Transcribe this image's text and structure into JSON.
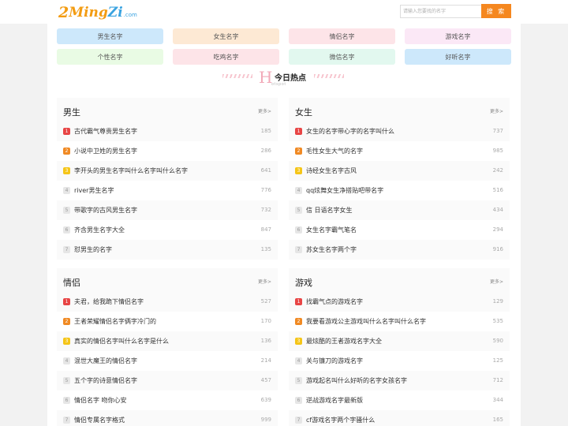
{
  "header": {
    "logo_num": "2",
    "logo_m": "M",
    "logo_ing": "ing",
    "logo_z": "Zi",
    "logo_dotcom": ".com",
    "search_placeholder": "请输入您要找的名字",
    "search_button": "搜 索"
  },
  "categories": [
    {
      "label": "男生名字",
      "color": "#cde8fb"
    },
    {
      "label": "女生名字",
      "color": "#fde9d4"
    },
    {
      "label": "情侣名字",
      "color": "#fde4e8"
    },
    {
      "label": "游戏名字",
      "color": "#fbe8f6"
    },
    {
      "label": "个性名字",
      "color": "#e9fbe4"
    },
    {
      "label": "吃鸡名字",
      "color": "#fde4e8"
    },
    {
      "label": "微信名字",
      "color": "#e2f8ef"
    },
    {
      "label": "好听名字",
      "color": "#cde8fb"
    }
  ],
  "hot": {
    "big_letter": "H",
    "label": "今日热点",
    "sub": "otspot"
  },
  "more_label": "更多>",
  "panels": [
    {
      "title": "男生",
      "items": [
        {
          "rank": "1",
          "text": "古代霸气尊贵男生名字",
          "count": "185"
        },
        {
          "rank": "2",
          "text": "小说中卫姓的男生名字",
          "count": "286"
        },
        {
          "rank": "3",
          "text": "李开头的男生名字叫什么名字叫什么名字",
          "count": "641"
        },
        {
          "rank": "4",
          "text": "river男生名字",
          "count": "776"
        },
        {
          "rank": "5",
          "text": "带歌字的古风男生名字",
          "count": "732"
        },
        {
          "rank": "6",
          "text": "齐含男生名字大全",
          "count": "847"
        },
        {
          "rank": "7",
          "text": "怼男生的名字",
          "count": "135"
        }
      ]
    },
    {
      "title": "女生",
      "items": [
        {
          "rank": "1",
          "text": "女生的名字带心字的名字叫什么",
          "count": "737"
        },
        {
          "rank": "2",
          "text": "毛性女生大气的名字",
          "count": "985"
        },
        {
          "rank": "3",
          "text": "诗经女生名字古风",
          "count": "242"
        },
        {
          "rank": "4",
          "text": "qq炫舞女生净搭贴吧带名字",
          "count": "516"
        },
        {
          "rank": "5",
          "text": "信 日语名字女生",
          "count": "434"
        },
        {
          "rank": "6",
          "text": "女生名字霸气笔名",
          "count": "294"
        },
        {
          "rank": "7",
          "text": "苏女生名字两个字",
          "count": "916"
        }
      ]
    },
    {
      "title": "情侣",
      "items": [
        {
          "rank": "1",
          "text": "夫君，给我跪下情侣名字",
          "count": "527"
        },
        {
          "rank": "2",
          "text": "王者荣耀情侣名字俩字冷门的",
          "count": "170"
        },
        {
          "rank": "3",
          "text": "真实的情侣名字叫什么名字是什么",
          "count": "136"
        },
        {
          "rank": "4",
          "text": "混世大魔王的情侣名字",
          "count": "214"
        },
        {
          "rank": "5",
          "text": "五个字的诗意情侣名字",
          "count": "457"
        },
        {
          "rank": "6",
          "text": "情侣名字 吻你心安",
          "count": "639"
        },
        {
          "rank": "7",
          "text": "情侣专属名字格式",
          "count": "999"
        }
      ]
    },
    {
      "title": "游戏",
      "items": [
        {
          "rank": "1",
          "text": "找霸气点的游戏名字",
          "count": "129"
        },
        {
          "rank": "2",
          "text": "我要看游戏公主游戏叫什么名字叫什么名字",
          "count": "535"
        },
        {
          "rank": "3",
          "text": "最炫酷的王者游戏名字大全",
          "count": "590"
        },
        {
          "rank": "4",
          "text": "关与镰刀的游戏名字",
          "count": "125"
        },
        {
          "rank": "5",
          "text": "游戏起名叫什么好听的名字女孩名字",
          "count": "712"
        },
        {
          "rank": "6",
          "text": "逆战游戏名字最新版",
          "count": "344"
        },
        {
          "rank": "7",
          "text": "cf游戏名字两个字骚什么",
          "count": "165"
        }
      ]
    }
  ]
}
